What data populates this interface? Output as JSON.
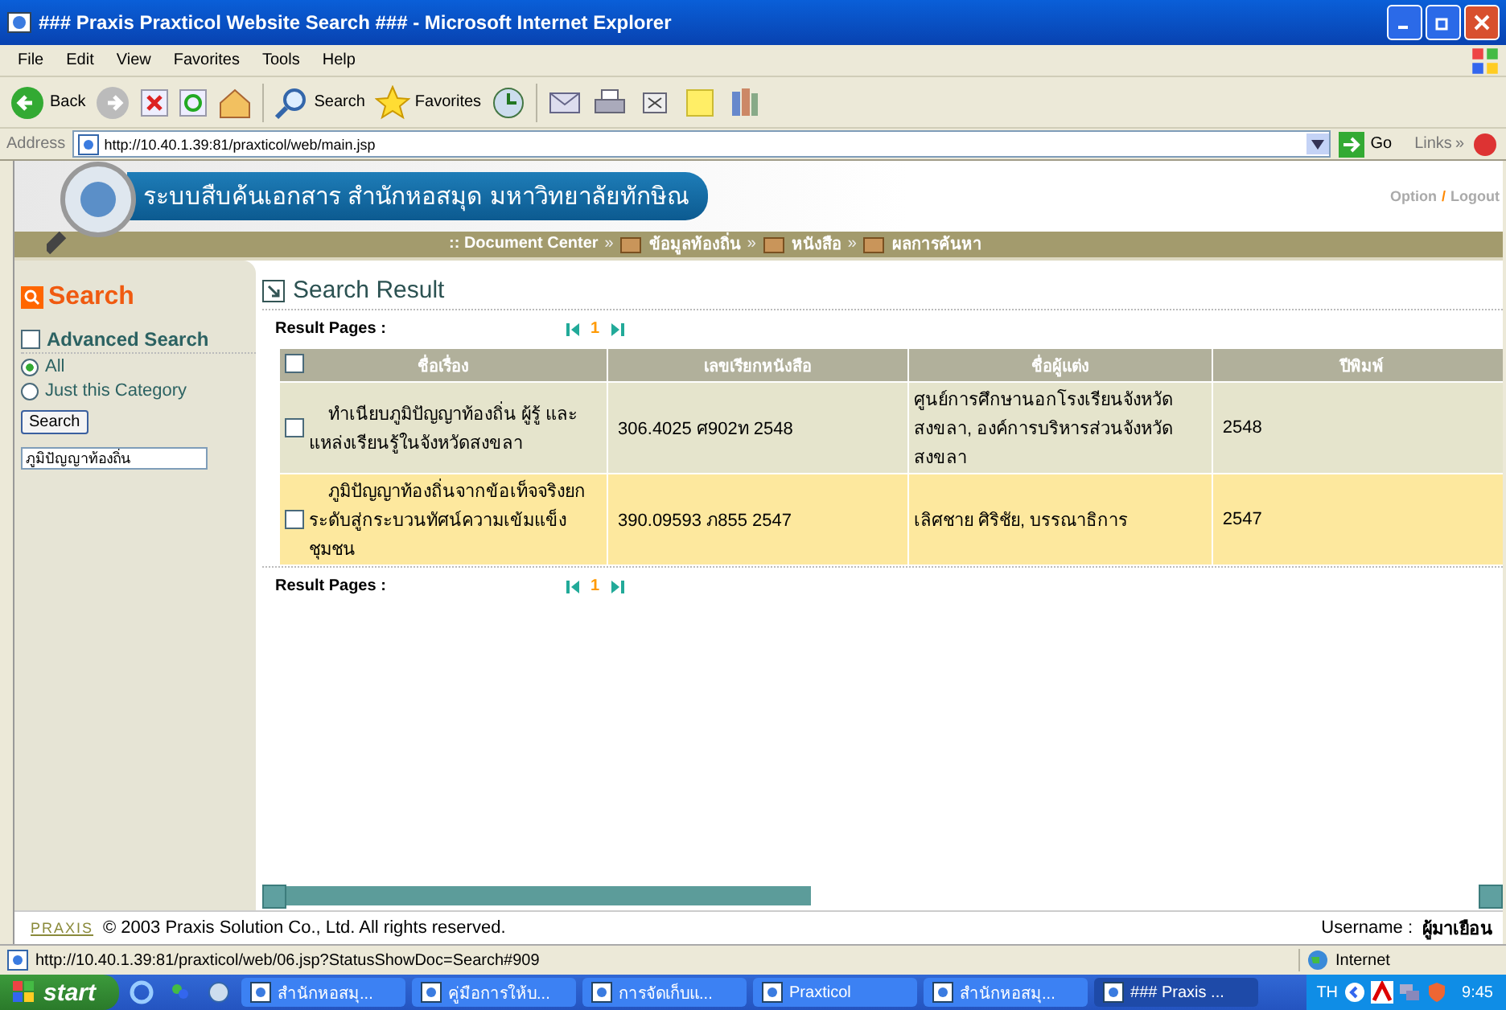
{
  "window": {
    "title": "### Praxis Praxticol Website Search ### - Microsoft Internet Explorer"
  },
  "menu": [
    "File",
    "Edit",
    "View",
    "Favorites",
    "Tools",
    "Help"
  ],
  "toolbar": {
    "back": "Back",
    "search": "Search",
    "favorites": "Favorites"
  },
  "address_bar": {
    "label": "Address",
    "url": "http://10.40.1.39:81/praxticol/web/main.jsp",
    "go": "Go",
    "links": "Links",
    "links_more": "»"
  },
  "banner": {
    "title": "ระบบสืบค้นเอกสาร สำนักหอสมุด มหาวิทยาลัยทักษิณ",
    "option": "Option",
    "separator": "/",
    "logout": "Logout"
  },
  "breadcrumb": [
    {
      "label": ":: Document Center",
      "icon": false
    },
    {
      "separator": "»",
      "label": "ข้อมูลท้องถิ่น",
      "icon": true
    },
    {
      "separator": "»",
      "label": "หนังสือ",
      "icon": true
    },
    {
      "separator": "»",
      "label": "ผลการค้นหา",
      "icon": true
    }
  ],
  "sidebar": {
    "title": "Search",
    "advanced": {
      "label": "Advanced Search",
      "checked": false
    },
    "scopes": [
      {
        "label": "All",
        "selected": true
      },
      {
        "label": "Just this Category",
        "selected": false
      }
    ],
    "button": "Search",
    "query": "ภูมิปัญญาท้องถิ่น"
  },
  "content": {
    "title": "Search Result",
    "pages_top": {
      "label": "Result Pages :",
      "pages": [
        {
          "label": "1"
        }
      ]
    },
    "table": {
      "select_all": false,
      "columns": [
        "ชื่อเรื่อง",
        "เลขเรียกหนังสือ",
        "ชื่อผู้แต่ง",
        "ปีพิมพ์"
      ],
      "rows": [
        {
          "checked": false,
          "cells": [
            "ทำเนียบภูมิปัญญาท้องถิ่น ผู้รู้ และแหล่งเรียนรู้ในจังหวัดสงขลา",
            "306.4025 ศ902ท 2548",
            "ศูนย์การศึกษานอกโรงเรียนจังหวัดสงขลา, องค์การบริหารส่วนจังหวัดสงขลา",
            "2548"
          ]
        },
        {
          "checked": false,
          "cells": [
            "ภูมิปัญญาท้องถิ่นจากข้อเท็จจริงยกระดับสู่กระบวนทัศน์ความเข้มแข็งชุมชน",
            "390.09593 ภ855 2547",
            "เลิศชาย ศิริชัย, บรรณาธิการ",
            "2547"
          ]
        }
      ]
    },
    "pages_bottom": {
      "label": "Result Pages :",
      "pages": [
        {
          "label": "1"
        }
      ]
    }
  },
  "footer": {
    "logo": "PRAXIS",
    "copyright": "© 2003 Praxis Solution Co., Ltd. All rights reserved.",
    "username_label": "Username :",
    "username": "ผู้มาเยือน"
  },
  "status_bar": {
    "url": "http://10.40.1.39:81/praxticol/web/06.jsp?StatusShowDoc=Search#909",
    "zone": "Internet"
  },
  "taskbar": {
    "start": "start",
    "tasks": [
      {
        "label": "สำนักหอสมุ...",
        "selected": false
      },
      {
        "label": "คู่มือการให้บ...",
        "selected": false
      },
      {
        "label": "การจัดเก็บแ...",
        "selected": false
      },
      {
        "label": "Praxticol",
        "selected": false
      },
      {
        "label": "สำนักหอสมุ...",
        "selected": false
      },
      {
        "label": "### Praxis ...",
        "selected": true
      }
    ],
    "language": "TH",
    "clock": "9:45"
  }
}
